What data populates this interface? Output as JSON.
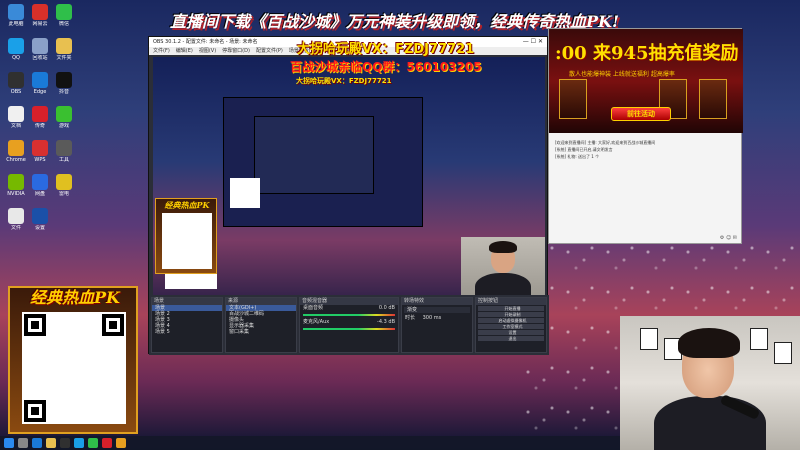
{
  "banner": {
    "top_text": "直播间下载《百战沙城》万元神装升级即领，经典传奇热血PK!"
  },
  "overlay": {
    "wechat": "大拐哈玩殿VX：FZDJ77721",
    "qq_group": "百战沙城亲临QQ群：560103205",
    "qq_group_small": "大拐哈玩殿VX：FZDJ77721"
  },
  "obs": {
    "title": "OBS 30.1.2 - 配置文件: 未命名 - 场景: 未命名",
    "menus": [
      "文件(F)",
      "编辑(E)",
      "视图(V)",
      "停靠窗口(D)",
      "配置文件(P)",
      "场景集合(S)",
      "工具(T)",
      "帮助(H)"
    ],
    "window_controls": "— ☐ ✕",
    "docks": {
      "scenes_title": "场景",
      "scenes": [
        "场景",
        "场景 2",
        "场景 3",
        "场景 4",
        "场景 5"
      ],
      "sources_title": "来源",
      "sources": [
        "文本(GDI+)",
        "百战沙城二维码",
        "摄像头",
        "显示器采集",
        "窗口采集"
      ],
      "mixer_title": "音频混音器",
      "mixer": [
        {
          "label": "桌面音频",
          "value": "0.0 dB"
        },
        {
          "label": "麦克风/Aux",
          "value": "-4.3 dB"
        }
      ],
      "transitions_title": "转场特效",
      "transition_value": "渐变",
      "duration_label": "时长",
      "duration_value": "300 ms",
      "controls_title": "控制按钮",
      "controls": [
        "开始直播",
        "开始录制",
        "启动虚拟摄像机",
        "工作室模式",
        "设置",
        "退出"
      ]
    }
  },
  "ad": {
    "title": ":00 来945抽充值奖励",
    "subtitle": "散人也能爆神装 上线就送福利 超高爆率",
    "button": "前往活动"
  },
  "chat": {
    "lines": [
      "[欢迎来到直播间] 主播: 大家好,欢迎来到百战沙城直播间",
      "[系统] 直播间已开启,请文明发言",
      "[系统] 礼物: 送出了 1 个"
    ]
  },
  "qr_promo": {
    "title": "经典热血PK",
    "small_title": "经典热血PK"
  },
  "desktop": {
    "icons": [
      {
        "label": "此电脑",
        "color": "#3a8ad8"
      },
      {
        "label": "网易云",
        "color": "#d8302a"
      },
      {
        "label": "微信",
        "color": "#2fbf4a"
      },
      {
        "label": "QQ",
        "color": "#1aa0e8"
      },
      {
        "label": "回收站",
        "color": "#8aa0c8"
      },
      {
        "label": "文件夹",
        "color": "#e8c050"
      },
      {
        "label": "OBS",
        "color": "#303030"
      },
      {
        "label": "Edge",
        "color": "#1a7ad8"
      },
      {
        "label": "抖音",
        "color": "#111111"
      },
      {
        "label": "文档",
        "color": "#f0f0f0"
      },
      {
        "label": "传奇",
        "color": "#d8202a"
      },
      {
        "label": "游戏",
        "color": "#3ac030"
      },
      {
        "label": "Chrome",
        "color": "#e8a020"
      },
      {
        "label": "WPS",
        "color": "#d83030"
      },
      {
        "label": "工具",
        "color": "#5a5a5a"
      },
      {
        "label": "NVIDIA",
        "color": "#76b900"
      },
      {
        "label": "网盘",
        "color": "#2a6ae0"
      },
      {
        "label": "雷电",
        "color": "#e0c020"
      },
      {
        "label": "文件",
        "color": "#e8e8e8"
      },
      {
        "label": "设置",
        "color": "#1a50a8"
      }
    ]
  },
  "taskbar": {
    "icons": [
      {
        "name": "start",
        "color": "#2a8af0"
      },
      {
        "name": "search",
        "color": "#888888"
      },
      {
        "name": "edge",
        "color": "#1a7ad8"
      },
      {
        "name": "explorer",
        "color": "#e8c050"
      },
      {
        "name": "obs",
        "color": "#303030"
      },
      {
        "name": "qq",
        "color": "#1aa0e8"
      },
      {
        "name": "wechat",
        "color": "#2fbf4a"
      },
      {
        "name": "game",
        "color": "#d8202a"
      },
      {
        "name": "chrome",
        "color": "#e8a020"
      }
    ]
  },
  "colors": {
    "overlay_yellow": "#ffe000",
    "overlay_red": "#ff1a1a",
    "obs_bg": "#2b2e38"
  }
}
